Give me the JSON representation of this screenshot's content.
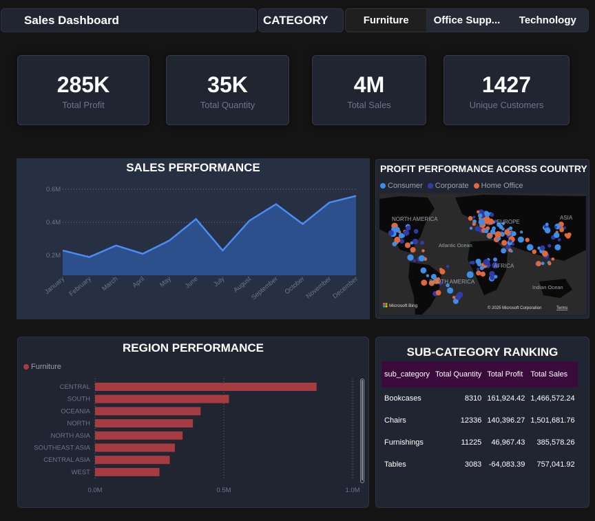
{
  "header": {
    "title": "Sales Dashboard",
    "category_label": "CATEGORY",
    "slicer": [
      {
        "label": "Furniture",
        "active": true
      },
      {
        "label": "Office Supp...",
        "active": false
      },
      {
        "label": "Technology",
        "active": false
      }
    ]
  },
  "kpis": [
    {
      "value": "285K",
      "label": "Total Profit"
    },
    {
      "value": "35K",
      "label": "Total Quantity"
    },
    {
      "value": "4M",
      "label": "Total Sales"
    },
    {
      "value": "1427",
      "label": "Unique Customers"
    }
  ],
  "colors": {
    "area_line": "#4b8cf5",
    "area_fill": "#2d4f8c",
    "bar": "#a63c42",
    "consumer": "#3d8ee8",
    "corporate": "#2f3ca8",
    "home_office": "#e0683a",
    "table_header": "#3a0a3c"
  },
  "sales_chart": {
    "title": "SALES PERFORMANCE",
    "chart_data": {
      "type": "area",
      "categories": [
        "January",
        "February",
        "March",
        "April",
        "May",
        "June",
        "July",
        "August",
        "September",
        "October",
        "November",
        "December"
      ],
      "values": [
        0.23,
        0.19,
        0.26,
        0.21,
        0.29,
        0.42,
        0.23,
        0.41,
        0.51,
        0.39,
        0.52,
        0.56
      ],
      "yticks": [
        "0.2M",
        "0.4M",
        "0.6M"
      ],
      "ytick_values": [
        0.2,
        0.4,
        0.6
      ],
      "ylim": [
        0.08,
        0.65
      ],
      "grid": true
    }
  },
  "map": {
    "title": "PROFIT PERFORMANCE ACORSS COUNTRY",
    "legend": [
      {
        "label": "Consumer",
        "color": "#3d8ee8"
      },
      {
        "label": "Corporate",
        "color": "#2f3ca8"
      },
      {
        "label": "Home Office",
        "color": "#e0683a"
      }
    ],
    "labels": {
      "north_america": "NORTH AMERICA",
      "europe": "EUROPE",
      "asia": "ASIA",
      "atlantic": "Atlantic Ocean",
      "africa": "AFRICA",
      "south_america": "SOUTH AMERICA",
      "indian": "Indian Ocean"
    },
    "attribution": "Microsoft Bing",
    "copyright": "© 2025 Microsoft Corporation",
    "terms": "Terms"
  },
  "region_chart": {
    "title": "REGION PERFORMANCE",
    "legend": "Furniture",
    "chart_data": {
      "type": "bar",
      "orientation": "horizontal",
      "categories": [
        "CENTRAL",
        "SOUTH",
        "OCEANIA",
        "NORTH",
        "NORTH ASIA",
        "SOUTHEAST ASIA",
        "CENTRAL ASIA",
        "WEST"
      ],
      "values": [
        0.86,
        0.52,
        0.41,
        0.38,
        0.34,
        0.31,
        0.29,
        0.25
      ],
      "xticks": [
        "0.0M",
        "0.5M",
        "1.0M"
      ],
      "xtick_values": [
        0,
        0.5,
        1.0
      ],
      "xlim": [
        0,
        1.0
      ],
      "series": [
        {
          "name": "Furniture",
          "values": [
            0.86,
            0.52,
            0.41,
            0.38,
            0.34,
            0.31,
            0.29,
            0.25
          ]
        }
      ]
    }
  },
  "subcategory": {
    "title": "SUB-CATEGORY RANKING",
    "columns": [
      "sub_category",
      "Total Quantity",
      "Total Profit",
      "Total Sales"
    ],
    "rows": [
      [
        "Bookcases",
        "8310",
        "161,924.42",
        "1,466,572.24"
      ],
      [
        "Chairs",
        "12336",
        "140,396.27",
        "1,501,681.76"
      ],
      [
        "Furnishings",
        "11225",
        "46,967.43",
        "385,578.26"
      ],
      [
        "Tables",
        "3083",
        "-64,083.39",
        "757,041.92"
      ]
    ]
  }
}
